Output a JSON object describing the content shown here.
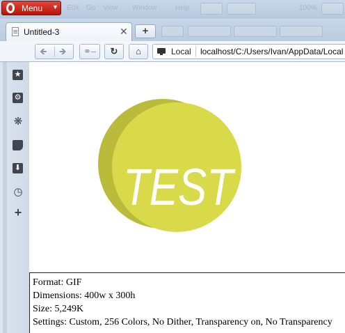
{
  "menu": {
    "label": "Menu"
  },
  "menubar_faint": [
    "Edit",
    "Go",
    "View",
    "Window",
    "Help",
    "100%"
  ],
  "tabs": [
    {
      "title": "Untitled-3"
    }
  ],
  "address": {
    "security_label": "Local",
    "url": "localhost/C:/Users/Ivan/AppData/Local"
  },
  "sidebar": {
    "icons": [
      "bookmarks-icon",
      "settings-icon",
      "unite-icon",
      "notes-icon",
      "downloads-icon",
      "history-icon",
      "add-panel-icon"
    ]
  },
  "content": {
    "logo_text": "TEST",
    "colors": {
      "circle_front": "#d9da4a",
      "circle_back": "#babb3a",
      "text": "#ffffff"
    }
  },
  "image_info": {
    "format": "Format: GIF",
    "dimensions": "Dimensions: 400w x 300h",
    "size": "Size: 5,249K",
    "settings": "Settings: Custom, 256 Colors, No Dither, Transparency on, No Transparency"
  }
}
